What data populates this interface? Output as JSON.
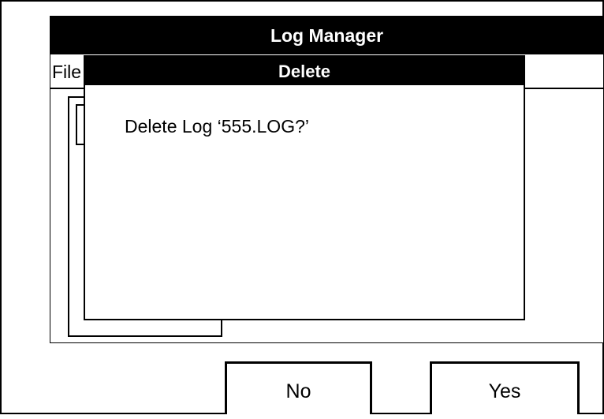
{
  "window": {
    "title": "Log Manager",
    "menu": {
      "file_label": "File"
    }
  },
  "dialog": {
    "title": "Delete",
    "message": "Delete Log ‘555.LOG?’"
  },
  "buttons": {
    "no_label": "No",
    "yes_label": "Yes"
  }
}
